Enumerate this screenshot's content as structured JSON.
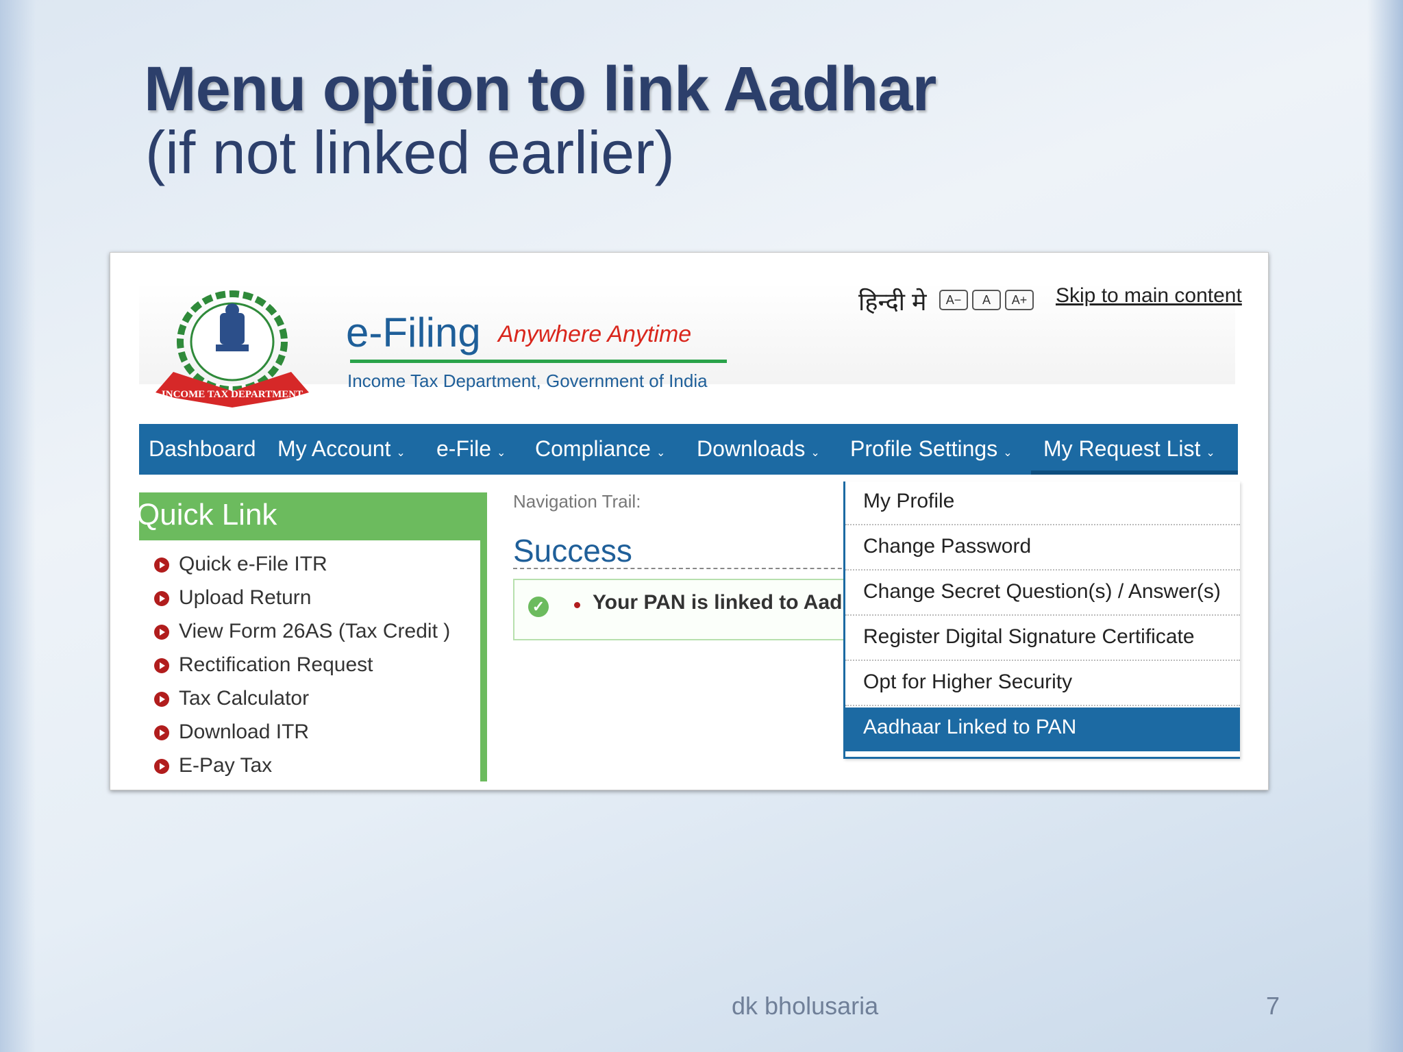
{
  "slide": {
    "title": "Menu option to link Aadhar",
    "subtitle": "(if not linked earlier)",
    "footer_author": "dk bholusaria",
    "page_number": "7"
  },
  "header": {
    "brand": "e-Filing",
    "tagline": "Anywhere Anytime",
    "department": "Income Tax Department, Government of India",
    "emblem_banner": "INCOME TAX DEPARTMENT",
    "hindi_link": "हिन्दी मे",
    "font_buttons": [
      "A−",
      "A",
      "A+"
    ],
    "skip_link": "Skip to main content"
  },
  "nav": {
    "items": [
      {
        "label": "Dashboard",
        "caret": ""
      },
      {
        "label": "My Account",
        "caret": "⌄"
      },
      {
        "label": "e-File",
        "caret": "⌄"
      },
      {
        "label": "Compliance",
        "caret": "⌄"
      },
      {
        "label": "Downloads",
        "caret": "⌄"
      },
      {
        "label": "Profile Settings",
        "caret": "⌄"
      },
      {
        "label": "My Request List",
        "caret": "⌄"
      }
    ]
  },
  "quick_link": {
    "title": "Quick Link",
    "items": [
      "Quick e-File ITR",
      "Upload Return",
      "View Form 26AS (Tax Credit )",
      "Rectification Request",
      "Tax Calculator",
      "Download ITR",
      "E-Pay Tax"
    ]
  },
  "main": {
    "nav_trail": "Navigation Trail:",
    "status_title": "Success",
    "message": "Your PAN is linked to Aadhaar"
  },
  "profile_dropdown": {
    "items": [
      "My Profile",
      "Change Password",
      "Change Secret Question(s) / Answer(s)",
      "Register Digital Signature Certificate",
      "Opt for Higher Security",
      "Aadhaar Linked to PAN"
    ],
    "active_index": 5
  },
  "colors": {
    "title": "#2c3f6b",
    "nav_bar": "#1c6aa3",
    "quick_link_green": "#6cbb5e",
    "tagline_red": "#d9261c",
    "brand_blue": "#1f5f99"
  }
}
